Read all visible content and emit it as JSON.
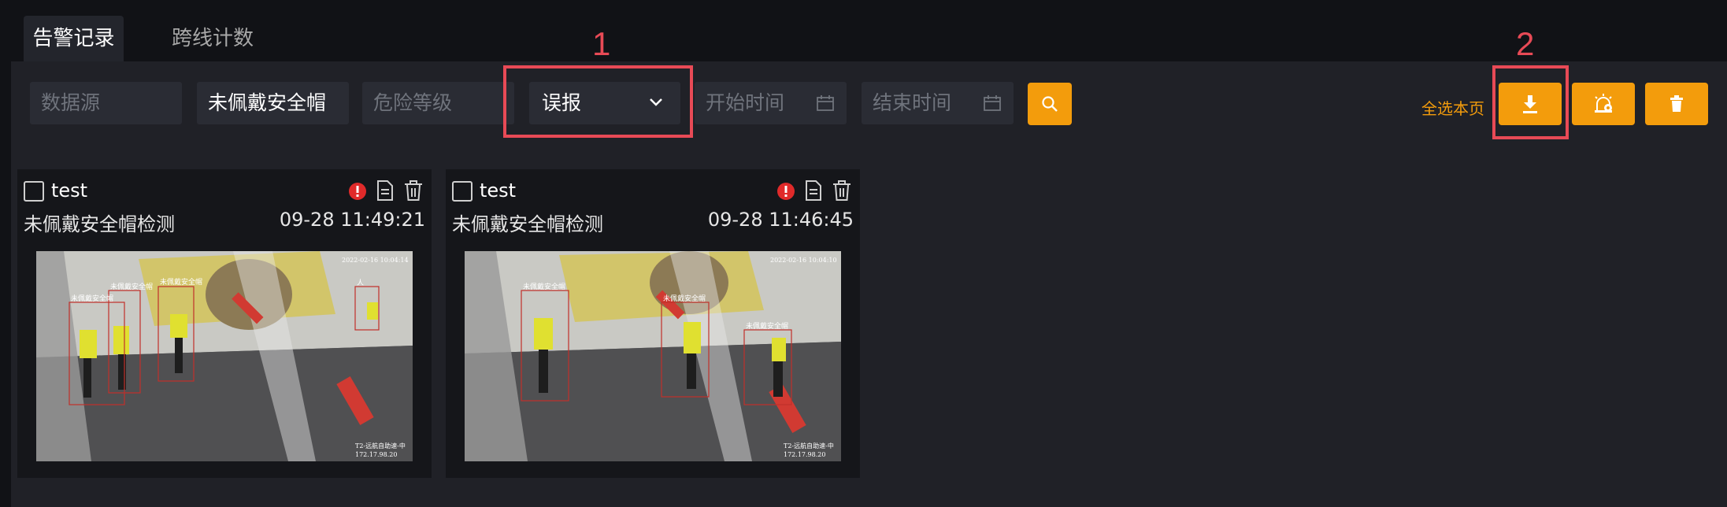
{
  "tabs": [
    {
      "label": "告警记录",
      "active": true
    },
    {
      "label": "跨线计数",
      "active": false
    }
  ],
  "filters": {
    "data_source_placeholder": "数据源",
    "alert_type_value": "未佩戴安全帽",
    "risk_level_placeholder": "危险等级",
    "status_select_value": "误报",
    "start_time_placeholder": "开始时间",
    "end_time_placeholder": "结束时间"
  },
  "actions": {
    "select_all_label": "全选本页"
  },
  "annotations": {
    "marker_1": "1",
    "marker_2": "2"
  },
  "cards": [
    {
      "source": "test",
      "title": "未佩戴安全帽检测",
      "time": "09-28 11:49:21",
      "labels": [
        "未佩戴安全帽",
        "未佩戴安全帽",
        "未佩戴安全帽",
        "人"
      ],
      "stamp": "2022-02-16 10:04:14",
      "caption": "T2-远航自助速-中",
      "ip": "172.17.98.20"
    },
    {
      "source": "test",
      "title": "未佩戴安全帽检测",
      "time": "09-28 11:46:45",
      "labels": [
        "未佩戴安全帽",
        "未佩戴安全帽",
        "未佩戴安全帽"
      ],
      "stamp": "2022-02-16 10:04:10",
      "caption": "T2-远航自助速-中",
      "ip": "172.17.98.20"
    }
  ],
  "colors": {
    "accent": "#f39c0c",
    "annotation": "#e84a56",
    "background": "#111216",
    "panel": "#202127",
    "alert": "#e02a2a"
  }
}
